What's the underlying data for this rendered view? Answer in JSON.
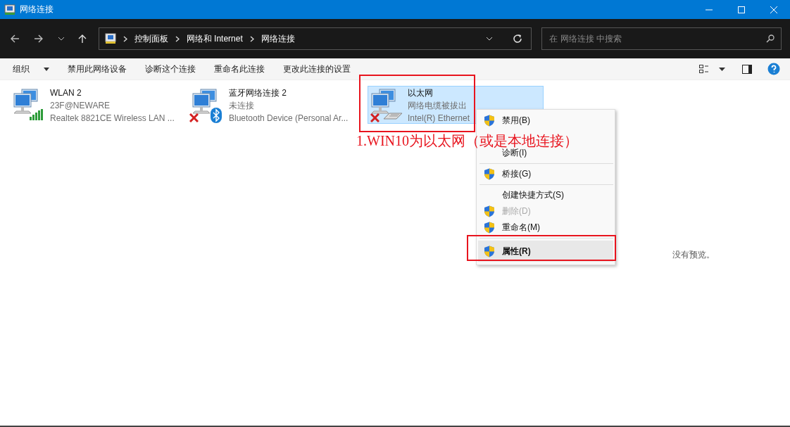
{
  "window": {
    "title": "网络连接"
  },
  "address_bar": {
    "breadcrumbs": [
      "控制面板",
      "网络和 Internet",
      "网络连接"
    ]
  },
  "search": {
    "placeholder": "在 网络连接 中搜索"
  },
  "command_bar": [
    {
      "label": "组织",
      "dropdown": true
    },
    {
      "label": "禁用此网络设备",
      "dropdown": false
    },
    {
      "label": "诊断这个连接",
      "dropdown": false
    },
    {
      "label": "重命名此连接",
      "dropdown": false
    },
    {
      "label": "更改此连接的设置",
      "dropdown": false
    }
  ],
  "connections": [
    {
      "name": "WLAN 2",
      "status": "23F@NEWARE",
      "device": "Realtek 8821CE Wireless LAN ...",
      "kind": "wifi",
      "selected": false
    },
    {
      "name": "蓝牙网络连接 2",
      "status": "未连接",
      "device": "Bluetooth Device (Personal Ar...",
      "kind": "bluetooth",
      "selected": false
    },
    {
      "name": "以太网",
      "status": "网络电缆被拔出",
      "device": "Intel(R) Ethernet",
      "kind": "cable",
      "selected": true
    }
  ],
  "context_menu": [
    {
      "kind": "item",
      "label": "禁用(B)",
      "shield": true,
      "disabled": false,
      "default": false,
      "selected": false
    },
    {
      "kind": "hidden"
    },
    {
      "kind": "item",
      "label": "诊断(I)",
      "shield": false,
      "disabled": false,
      "default": false,
      "selected": false
    },
    {
      "kind": "separator"
    },
    {
      "kind": "item",
      "label": "桥接(G)",
      "shield": true,
      "disabled": false,
      "default": false,
      "selected": false
    },
    {
      "kind": "separator"
    },
    {
      "kind": "item",
      "label": "创建快捷方式(S)",
      "shield": false,
      "disabled": false,
      "default": false,
      "selected": false
    },
    {
      "kind": "item",
      "label": "删除(D)",
      "shield": true,
      "disabled": true,
      "default": false,
      "selected": false
    },
    {
      "kind": "item",
      "label": "重命名(M)",
      "shield": true,
      "disabled": false,
      "default": false,
      "selected": false
    },
    {
      "kind": "separator"
    },
    {
      "kind": "item",
      "label": "属性(R)",
      "shield": true,
      "disabled": false,
      "default": true,
      "selected": true
    }
  ],
  "preview_pane": {
    "message": "没有预览。"
  },
  "annotation": {
    "text": "1.WIN10为以太网（或是本地连接）"
  }
}
